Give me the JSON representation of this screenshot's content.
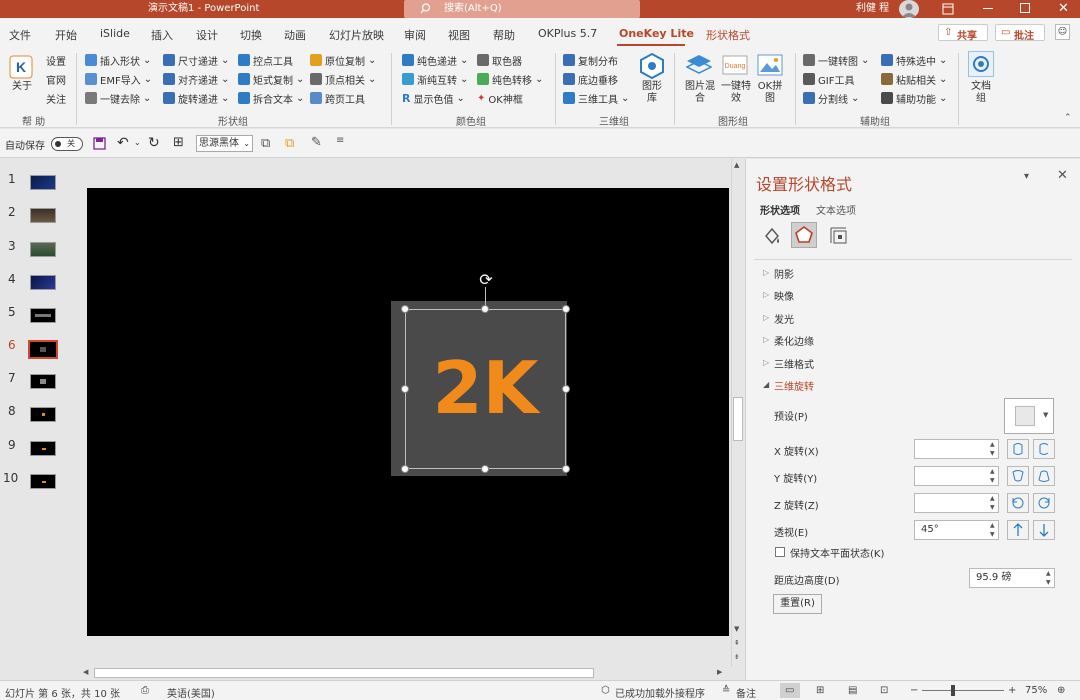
{
  "window": {
    "title": "演示文稿1 - PowerPoint",
    "search_placeholder": "搜索(Alt+Q)",
    "user_name": "利健 程",
    "accent": "#b7472a"
  },
  "tabs": [
    "文件",
    "开始",
    "iSlide",
    "插入",
    "设计",
    "切换",
    "动画",
    "幻灯片放映",
    "审阅",
    "视图",
    "帮助",
    "OKPlus 5.7",
    "OneKey Lite",
    "形状格式"
  ],
  "tab_actions": {
    "share": "共享",
    "comment": "批注"
  },
  "ribbon": {
    "help_group": {
      "about": "关于",
      "settings": "设置",
      "website": "官网",
      "follow": "关注",
      "name": "帮 助"
    },
    "shape_group": {
      "items": [
        "插入形状",
        "尺寸递进",
        "控点工具",
        "原位复制",
        "EMF导入",
        "对齐递进",
        "矩式复制",
        "顶点相关",
        "一键去除",
        "旋转递进",
        "拆合文本",
        "跨页工具"
      ],
      "name": "形状组"
    },
    "color_group": {
      "items": [
        "纯色递进",
        "取色器",
        "渐纯互转",
        "纯色转移",
        "显示色值",
        "OK神框"
      ],
      "big": "图形库",
      "name": "颜色组"
    },
    "3d_group": {
      "items": [
        "复制分布",
        "底边垂移",
        "三维工具"
      ],
      "name": "三维组"
    },
    "image_group": {
      "big1": "图片混合",
      "big2": "一键特效",
      "big3": "OK拼图",
      "name": "图形组"
    },
    "assist_group": {
      "items": [
        "一键转图",
        "特殊选中",
        "GIF工具",
        "粘贴相关",
        "分割线",
        "辅助功能"
      ],
      "name": "辅助组"
    },
    "doc_group": {
      "big": "文档组"
    }
  },
  "qat": {
    "autosave_label": "自动保存",
    "autosave_state": "关",
    "font": "思源黑体"
  },
  "slides": [
    {
      "num": "1"
    },
    {
      "num": "2"
    },
    {
      "num": "3"
    },
    {
      "num": "4"
    },
    {
      "num": "5"
    },
    {
      "num": "6",
      "active": true
    },
    {
      "num": "7"
    },
    {
      "num": "8"
    },
    {
      "num": "9"
    },
    {
      "num": "10"
    }
  ],
  "slide": {
    "shape_text": "2K",
    "text_color": "#f08a1a"
  },
  "pane": {
    "title": "设置形状格式",
    "tab_shape": "形状选项",
    "tab_text": "文本选项",
    "sections": [
      "阴影",
      "映像",
      "发光",
      "柔化边缘",
      "三维格式",
      "三维旋转"
    ],
    "preset_label": "预设(P)",
    "x_label": "X 旋转(X)",
    "y_label": "Y 旋转(Y)",
    "z_label": "Z 旋转(Z)",
    "perspective_label": "透视(E)",
    "perspective_value": "45°",
    "keep_flat_label": "保持文本平面状态(K)",
    "distance_label": "距底边高度(D)",
    "distance_value": "95.9 磅",
    "reset_label": "重置(R)"
  },
  "status": {
    "slide_info": "幻灯片 第 6 张，共 10 张",
    "language": "英语(美国)",
    "addin": "已成功加载外接程序",
    "notes": "备注",
    "zoom": "75%"
  }
}
